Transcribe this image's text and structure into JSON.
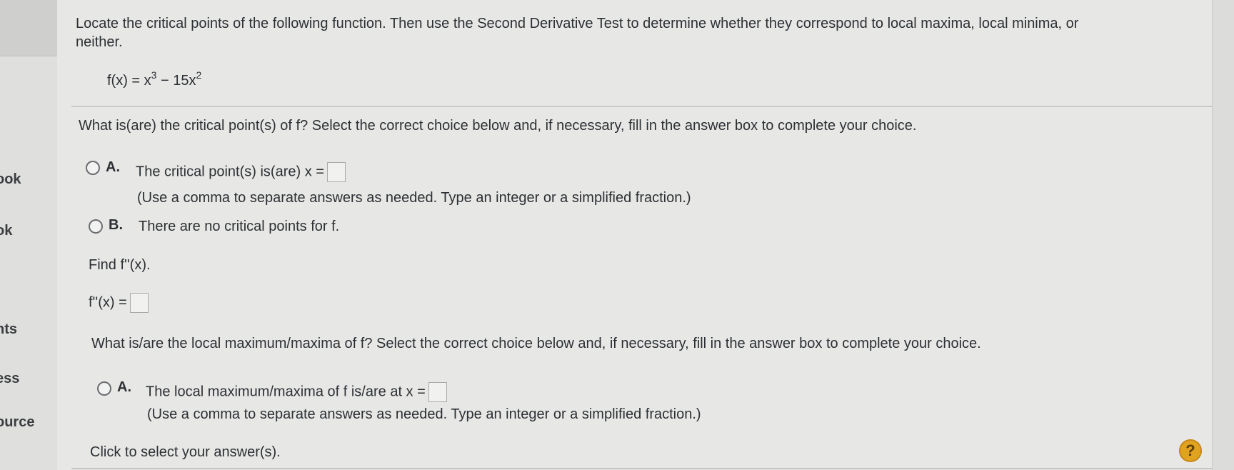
{
  "sidebar": {
    "items": [
      {
        "label": "ook"
      },
      {
        "label": "ok"
      },
      {
        "label": "nts"
      },
      {
        "label": "ess"
      },
      {
        "label": "ource"
      }
    ]
  },
  "question": {
    "instruction_line1": "Locate the critical points of the following function. Then use the Second Derivative Test to determine whether they correspond to local maxima, local minima, or",
    "instruction_line2": "neither.",
    "function_lhs": "f(x) = x",
    "function_exp1": "3",
    "function_mid": " − 15x",
    "function_exp2": "2"
  },
  "part1": {
    "prompt": "What is(are) the critical point(s) of f? Select the correct choice below and, if necessary, fill in the answer box to complete your choice.",
    "option_a_letter": "A.",
    "option_a_text": "The critical point(s) is(are) x =",
    "option_a_hint": "(Use a comma to separate answers as needed. Type an integer or a simplified fraction.)",
    "option_b_letter": "B.",
    "option_b_text": "There are no critical points for f."
  },
  "part2": {
    "prompt": "Find f''(x).",
    "lhs": "f''(x) ="
  },
  "part3": {
    "prompt": "What is/are the local maximum/maxima of f? Select the correct choice below and, if necessary, fill in the answer box to complete your choice.",
    "option_a_letter": "A.",
    "option_a_text": "The local maximum/maxima of f is/are at x =",
    "option_a_hint": "(Use a comma to separate answers as needed. Type an integer or a simplified fraction.)"
  },
  "footer": {
    "status": "Click to select your answer(s).",
    "help_label": "?"
  }
}
